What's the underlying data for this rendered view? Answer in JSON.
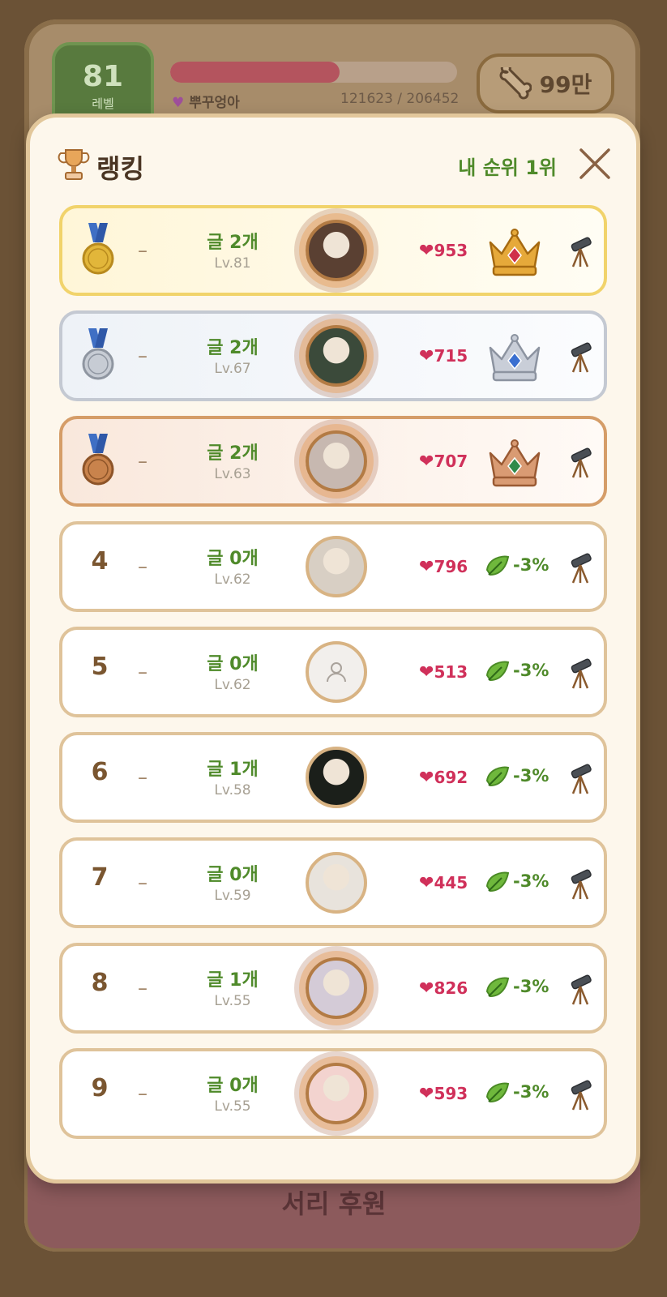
{
  "background": {
    "level_value": "81",
    "level_label": "레벨",
    "xp_progress": 0.589,
    "username": "뿌꾸엉아",
    "xp_text": "121623 / 206452",
    "bones_label": "99만",
    "support_label": "서리 후원"
  },
  "modal": {
    "title": "랭킹",
    "my_rank": "내 순위 1위",
    "icons": {
      "title": "trophy-icon",
      "close": "close-icon"
    }
  },
  "ranking": [
    {
      "rank": "1",
      "tier": "gold",
      "change": "–",
      "posts": "글 2개",
      "level": "Lv.81",
      "hearts": "953",
      "reward": "crown-ruby",
      "colors": {
        "gem": "#d0304a"
      }
    },
    {
      "rank": "2",
      "tier": "silver",
      "change": "–",
      "posts": "글 2개",
      "level": "Lv.67",
      "hearts": "715",
      "reward": "crown-sapphire",
      "colors": {
        "gem": "#3a6fd0"
      }
    },
    {
      "rank": "3",
      "tier": "bronze",
      "change": "–",
      "posts": "글 2개",
      "level": "Lv.63",
      "hearts": "707",
      "reward": "crown-emerald",
      "colors": {
        "gem": "#2f8a4a"
      }
    },
    {
      "rank": "4",
      "tier": "",
      "change": "–",
      "posts": "글 0개",
      "level": "Lv.62",
      "hearts": "796",
      "reward": "leaf",
      "pct": "-3%"
    },
    {
      "rank": "5",
      "tier": "",
      "change": "–",
      "posts": "글 0개",
      "level": "Lv.62",
      "hearts": "513",
      "reward": "leaf",
      "pct": "-3%"
    },
    {
      "rank": "6",
      "tier": "",
      "change": "–",
      "posts": "글 1개",
      "level": "Lv.58",
      "hearts": "692",
      "reward": "leaf",
      "pct": "-3%"
    },
    {
      "rank": "7",
      "tier": "",
      "change": "–",
      "posts": "글 0개",
      "level": "Lv.59",
      "hearts": "445",
      "reward": "leaf",
      "pct": "-3%"
    },
    {
      "rank": "8",
      "tier": "",
      "change": "–",
      "posts": "글 1개",
      "level": "Lv.55",
      "hearts": "826",
      "reward": "leaf",
      "pct": "-3%"
    },
    {
      "rank": "9",
      "tier": "",
      "change": "–",
      "posts": "글 0개",
      "level": "Lv.55",
      "hearts": "593",
      "reward": "leaf",
      "pct": "-3%"
    }
  ],
  "colors": {
    "accent_green": "#4f8a2a",
    "heart_red": "#d0305a",
    "frame_tan": "#dfc39a"
  }
}
